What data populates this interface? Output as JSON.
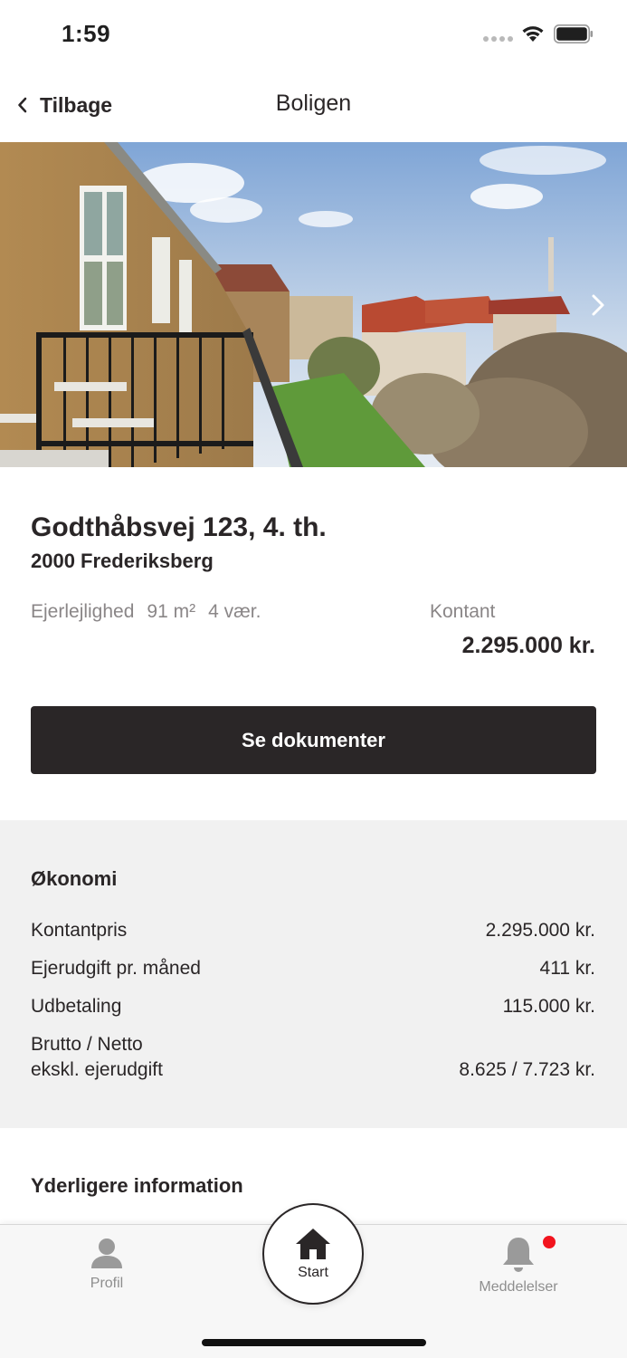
{
  "status_bar": {
    "time": "1:59"
  },
  "nav": {
    "back_label": "Tilbage",
    "title": "Boligen"
  },
  "property": {
    "address": "Godthåbsvej 123, 4. th.",
    "city": "2000 Frederiksberg",
    "specs": [
      "Ejerlejlighed",
      "91 m²",
      "4 vær."
    ],
    "price_label": "Kontant",
    "price_value": "2.295.000 kr."
  },
  "actions": {
    "documents_label": "Se dokumenter"
  },
  "economy": {
    "title": "Økonomi",
    "rows": [
      {
        "label": "Kontantpris",
        "value": "2.295.000 kr."
      },
      {
        "label": "Ejerudgift pr. måned",
        "value": "411 kr."
      },
      {
        "label": "Udbetaling",
        "value": "115.000 kr."
      },
      {
        "label": "Brutto / Netto\nekskl. ejerudgift",
        "value": "8.625 / 7.723 kr."
      }
    ]
  },
  "more_info": {
    "title": "Yderligere information"
  },
  "tabs": {
    "profile": "Profil",
    "start": "Start",
    "notifications": "Meddelelser"
  },
  "colors": {
    "primary": "#2a2627",
    "muted": "#8a8687",
    "section_bg": "#f1f1f1",
    "badge": "#f2141e"
  },
  "icons": [
    "chevron-left-icon",
    "chevron-right-icon",
    "person-icon",
    "home-icon",
    "bell-icon",
    "wifi-icon",
    "battery-icon"
  ]
}
